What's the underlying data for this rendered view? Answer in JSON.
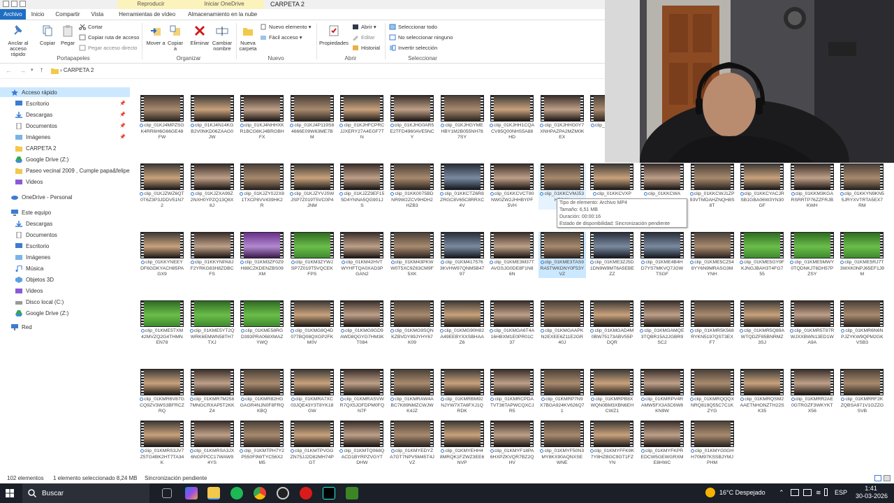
{
  "window": {
    "title": "CARPETA 2",
    "context_tabs": [
      "Reproducir",
      "Iniciar OneDrive"
    ]
  },
  "ribbon_tabs": [
    "Archivo",
    "Inicio",
    "Compartir",
    "Vista",
    "Herramientas de vídeo",
    "Almacenamiento en la nube"
  ],
  "ribbon": {
    "portapapeles": {
      "caption": "Portapapeles",
      "anclar": "Anclar al acceso rápido",
      "copiar": "Copiar",
      "pegar": "Pegar",
      "cortar": "Cortar",
      "copiar_ruta": "Copiar ruta de acceso",
      "pegar_acceso": "Pegar acceso directo"
    },
    "organizar": {
      "caption": "Organizar",
      "mover": "Mover a",
      "copiar_a": "Copiar a",
      "eliminar": "Eliminar",
      "cambiar": "Cambiar nombre"
    },
    "nuevo": {
      "caption": "Nuevo",
      "nueva_carpeta": "Nueva carpeta",
      "nuevo_elemento": "Nuevo elemento ▾",
      "facil_acceso": "Fácil acceso ▾"
    },
    "abrir": {
      "caption": "Abrir",
      "propiedades": "Propiedades",
      "abrir": "Abrir ▾",
      "editar": "Editar",
      "historial": "Historial"
    },
    "seleccionar": {
      "caption": "Seleccionar",
      "todo": "Seleccionar todo",
      "ninguno": "No seleccionar ninguno",
      "invertir": "Invertir selección"
    }
  },
  "address": {
    "path": "CARPETA 2"
  },
  "nav": {
    "quick_access": "Acceso rápido",
    "items": [
      "Escritorio",
      "Descargas",
      "Documentos",
      "Imágenes",
      "CARPETA 2",
      "Google Drive (Z:)",
      "Paseo vecinal 2009 , Cumple papa&felipe 2",
      "Videos"
    ],
    "onedrive": "OneDrive - Personal",
    "this_pc": "Este equipo",
    "pc_items": [
      "Descargas",
      "Documentos",
      "Escritorio",
      "Imágenes",
      "Música",
      "Objetos 3D",
      "Videos",
      "Disco local (C:)",
      "Google Drive (Z:)"
    ],
    "network": "Red"
  },
  "files": [
    "clip_01KJ4MPZSGK4RR6H6G66GE48FW",
    "clip_01KJ4N14KGB2V0NKD06ZAAG0JW",
    "clip_01KJ4NHHXKR1BCG6KJ4BRGBHFX",
    "clip_01KJ4P119S84666E09W63ME7BM",
    "clip_01KJHFCPRCJJXERY27A4EGF7TN",
    "clip_01KJHG0AR5E2TFD4960AVE5NCY",
    "clip_01KJHGYMEHBY1M2B055NH787SY",
    "clip_01KJHH1CQACV85Q00NHS5A88HD",
    "clip_01KJHHG0Y7XNHPAZPA2MZM0KEX",
    "clip_01KJHJ4E5Q",
    "clip_01KJZWZ6QT0T6Z3P3JDDV51N72",
    "clip_01KJZXA99Z2NXH0YPZQ13Q8X8J",
    "clip_01KJZY0J2X81TXCP8VV439HK2R",
    "clip_01KJZYVJSWJSP7Z019T5VC0P4JNM",
    "clip_01KJZZ9EF155D4YNNA5QG901JS",
    "clip_01KK0075BDNR9W2ZCV9HDH2HZB3",
    "clip_01KKCTZ6R8ZRGC8V65C8RRXC4V",
    "clip_01KKCVCT80NW0ZW2JHHBYPF5VH",
    "clip_01KKCVMJ53HB24N",
    "clip_01KKCVXP",
    "clip_01KKCWA",
    "clip_01KKCWJ1ZP93VTMDAHZNQH8S8T",
    "clip_01KKCYACJRSB1GBA06W3YN30GF",
    "clip_01KKM3KGARSRRTP76ZZFRJBKWH",
    "clip_01KKYN9KN55JRYXVTRTA5EX7RM",
    "clip_01KKYNEEYDF6GDKYACH85PAGX9",
    "clip_01KKYNPA8JF2YRKG83H8ZDBCFS",
    "clip_01KM3ZF0Z9H88CZKDENZBS09XM",
    "clip_01KM3ZYWJSP7Z019T5VQCEKFPS",
    "clip_01KM42HVTWYHFTQA0XAD3PGAN2",
    "clip_01KM43PKWW0T5XC9Z63CM9F5XK",
    "clip_01KM4175763KVHW97QNM5B4797",
    "clip_01KME3M37TAVGSJG0DE8F1N86N",
    "clip_01KME3TAS9RA5TWKDNY0F53YVZ",
    "clip_01KME3ZJ5D1DN9W9MT6A5EBEZZ",
    "clip_01KME4B4HD7YS7MKVQ7JGWTSGF",
    "clip_01KME5CZ548YY6N9MRASG3MYNH",
    "clip_01KME5GY9FKJNGJBAH3T4FG755",
    "clip_01KME5MWY0TQDNKJT6DH57PZSY",
    "clip_01KME5RJ7T3WXK0NPJ65EF1J9M",
    "clip_01KME5TXM42MVZQ2G4THMNEN78",
    "clip_01KME5YT2QWRK6EMWN58TH7TXJ",
    "clip_01KME58RGD393PRA068XMAZYWQ",
    "clip_01KMG8Q4D077BQ08QXGP2FKM0V",
    "clip_01KMG9GD9AWD8QGYG7HM3KT084",
    "clip_01KMG9SQNKZBVDY89JYHY67K09",
    "clip_01KMG90H82A49EEBYXXSBHAAZ6",
    "clip_01KMGA6T4A16HBXM1E0PR01C37",
    "clip_01KMGAAPKN2EXEE6Z11E2GR40J",
    "clip_01KMGAD4M0BW75173ABV55PDQR",
    "clip_01KMGAMQE3TQBR15A2JGBR9SC2",
    "clip_01KMR5K568RYKN5197QST3EXF7",
    "clip_01KMR5Q89AWTQDZF85BNRMZ3SJ",
    "clip_01KMR5T87RWJXXBWN13ED1WA9A",
    "clip_01KMR6N6NPJZYKW9QPM2GKVSB3",
    "clip_01KMR6V87GCQ9ZV3WS3BFRCZRQ",
    "clip_01KMR7M2587MNGCRXAP5T2KKZ4",
    "clip_01KMR82HGGAGR4NJN0F8FRQKBQ",
    "clip_01KMRA7XC03JQE43Y3T8YK18GW",
    "clip_01KMRASVWR7QX5JOFDPM0FQN7F",
    "clip_01KMRAW4ABC7K89NMZCWJWK4JZ",
    "clip_01KMRBM92NJYW7XTA6FXJ1QRDK",
    "clip_01KMRCPDATVT36TAPWCQXCJR5",
    "clip_01KMRP7N9X7BGA924KV626Q71",
    "clip_01KMRPB8XWQN0BM3XBN6EHCWZ1",
    "clip_01KMRPV4RAMW5FX3A5C6W8KN9W",
    "clip_01KMRQQQXNRQ819Q55C7C1KZYG",
    "clip_01KMRQSM2AAETNHONZTH22SK35",
    "clip_01KMRR2AE0GTRGZF3WKYKTX56",
    "clip_01KMRRF2KZQBSA971V1GZZGSVB",
    "clip_01KMRS3JV7Z5TG4BK2HT7TA34K",
    "clip_01KMRSA3JX6NGPPCC17WAW94YS",
    "clip_01KMTPH7Y2P550F9WTYC56X2M5",
    "clip_01KMTPVGGZN75JJ2D82MH74PGT",
    "clip_01KMTQ068QACD1BYRPZVGYTDHW",
    "clip_01KMYEDYZA7GT7NPV5M45T4JVZ",
    "clip_01KMYEHH48MRQK1FZWZ3EE6NVP",
    "clip_01KMYF18PA6HXPZKVQR7BZ2QHV",
    "clip_01KMYF50N3MY8KX90AQNXSEWNE",
    "clip_01KMYFFK9K7Y8HZBGC9GT1FZYN",
    "clip_01KMYFKPREDCW5GEWGRXME8HWC",
    "clip_01KMYG0GHH70M97KSSBJYMJPHM"
  ],
  "tooltip": {
    "tipo": "Tipo de elemento: Archivo MP4",
    "tamano": "Tamaño: 6,51 MB",
    "duracion": "Duración: 00:00:16",
    "estado": "Estado de disponibilidad: Sincronización pendiente"
  },
  "status": {
    "count": "102 elementos",
    "selected": "1 elemento seleccionado  8,24 MB",
    "sync": "Sincronización pendiente"
  },
  "taskbar": {
    "search": "Buscar",
    "weather": "16°C  Despejado",
    "lang": "ESP",
    "time": "1:41",
    "date": "30-03-2026"
  },
  "colors": {
    "file_tab": "#1e6ec4",
    "selection": "#cce8ff",
    "context_tab": "#fcf2bb",
    "taskbar": "#1a1f28"
  }
}
